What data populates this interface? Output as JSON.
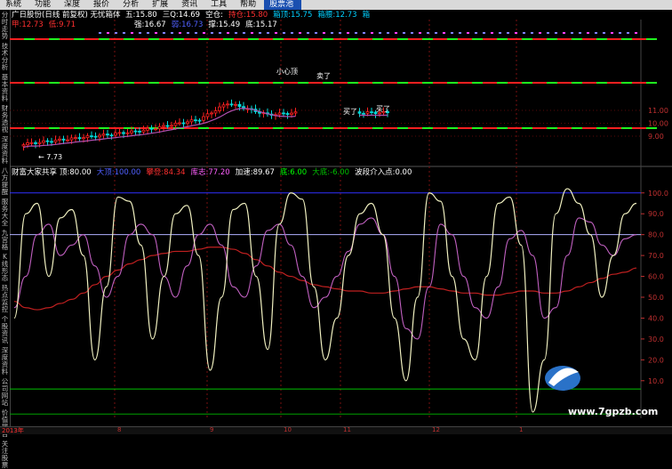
{
  "menu": {
    "items": [
      "系统",
      "功能",
      "深度",
      "报价",
      "分析",
      "扩展",
      "资讯",
      "工具",
      "帮助"
    ],
    "active_item": "股票池"
  },
  "side_tabs": [
    "分时走势",
    "技术分析",
    "基本资料",
    "财务透视",
    "深度资料",
    "八方提醒",
    "服务大全",
    "九宫格",
    "K线形态",
    "热点监控",
    "个股资讯",
    "深度资料",
    "公司网站",
    "价值报告",
    "关注股票"
  ],
  "kline": {
    "title": "广日股份(日线 前复权)",
    "indicator_name": "无忧箱体",
    "stats": [
      {
        "label": "五:",
        "value": "15.80",
        "color": "#ffffff"
      },
      {
        "label": "三Q:",
        "value": "14.69",
        "color": "#ffffff"
      },
      {
        "label": "空仓:",
        "value": "",
        "color": "#ffffff"
      },
      {
        "label": "持仓:",
        "value": "15.80",
        "color": "#ff3030"
      },
      {
        "label": "箱顶:",
        "value": "15.75",
        "color": "#00d0ff"
      },
      {
        "label": "箱腰:",
        "value": "12.73",
        "color": "#00d0ff"
      },
      {
        "label": "箱",
        "value": "",
        "color": "#00d0ff"
      }
    ],
    "stats2": [
      {
        "label": "甲:",
        "value": "12.73",
        "color": "#ff3030"
      },
      {
        "label": "低:",
        "value": "9.71",
        "color": "#ff3030"
      }
    ],
    "stats3": [
      {
        "label": "强:",
        "value": "16.67",
        "color": "#ffffff"
      },
      {
        "label": "弱:",
        "value": "16.73",
        "color": "#5060ff"
      },
      {
        "label": "撑:",
        "value": "15.49",
        "color": "#ffffff"
      },
      {
        "label": "底:",
        "value": "15.17",
        "color": "#ffffff"
      }
    ],
    "y_ticks": [
      "11.00",
      "10.00",
      "9.00"
    ],
    "annotations": [
      "小心顶",
      "卖了",
      "买了",
      "买了"
    ],
    "low_marker": "7.73",
    "up_color": "#ff2020",
    "down_color": "#00d8d8",
    "ma_color": "#b04fb0"
  },
  "osc": {
    "title": "财富大家共享",
    "stats": [
      {
        "label": "顶:",
        "value": "80.00",
        "color": "#ffffff"
      },
      {
        "label": "大顶:",
        "value": "100.00",
        "color": "#5060ff"
      },
      {
        "label": "攀登:",
        "value": "84.34",
        "color": "#ff3030"
      },
      {
        "label": "库志:",
        "value": "77.20",
        "color": "#ff60ff"
      },
      {
        "label": "加速:",
        "value": "89.67",
        "color": "#ffffff"
      },
      {
        "label": "底:",
        "value": "6.00",
        "color": "#00ff00"
      },
      {
        "label": "大底:",
        "value": "-6.00",
        "color": "#00c000"
      },
      {
        "label": "波段介入点:",
        "value": "0.00",
        "color": "#ffffff"
      }
    ],
    "y_ticks": [
      "100.0",
      "90.0",
      "80.0",
      "70.0",
      "60.0",
      "50.0",
      "40.0",
      "30.0",
      "20.0",
      "10.0"
    ],
    "line_white": [
      40,
      90,
      95,
      60,
      88,
      92,
      70,
      20,
      55,
      98,
      96,
      75,
      30,
      60,
      90,
      94,
      70,
      15,
      50,
      92,
      95,
      60,
      25,
      85,
      100,
      97,
      55,
      20,
      40,
      70,
      90,
      95,
      80,
      40,
      10,
      50,
      100,
      96,
      60,
      30,
      20,
      60,
      95,
      98,
      75,
      -5,
      20,
      90,
      102,
      95,
      80,
      50,
      70,
      90,
      95
    ],
    "line_magenta": [
      45,
      60,
      80,
      85,
      70,
      75,
      80,
      65,
      50,
      60,
      80,
      85,
      80,
      60,
      50,
      65,
      80,
      85,
      75,
      55,
      50,
      65,
      82,
      85,
      75,
      60,
      45,
      50,
      60,
      72,
      85,
      88,
      80,
      60,
      35,
      30,
      55,
      85,
      80,
      60,
      45,
      40,
      55,
      78,
      82,
      70,
      40,
      45,
      70,
      88,
      86,
      75,
      70,
      78,
      80
    ],
    "line_red": [
      48,
      45,
      44,
      45,
      47,
      49,
      52,
      56,
      60,
      63,
      66,
      68,
      70,
      71,
      72,
      72,
      73,
      74,
      74,
      73,
      71,
      68,
      65,
      62,
      60,
      58,
      56,
      55,
      54,
      53,
      53,
      52,
      52,
      53,
      54,
      55,
      55,
      54,
      53,
      52,
      52,
      51,
      51,
      52,
      53,
      53,
      52,
      52,
      53,
      55,
      57,
      59,
      61,
      62,
      64
    ],
    "hlines": [
      {
        "v": 100,
        "color": "#3030ff"
      },
      {
        "v": 80,
        "color": "#b0b0ff"
      },
      {
        "v": 6,
        "color": "#00c000"
      },
      {
        "v": -6,
        "color": "#00a000"
      }
    ]
  },
  "x_axis": {
    "year_label": "2013年",
    "labels": [
      "8",
      "9",
      "10",
      "11",
      "12",
      "1"
    ]
  },
  "watermark": "www.7gpzb.com"
}
